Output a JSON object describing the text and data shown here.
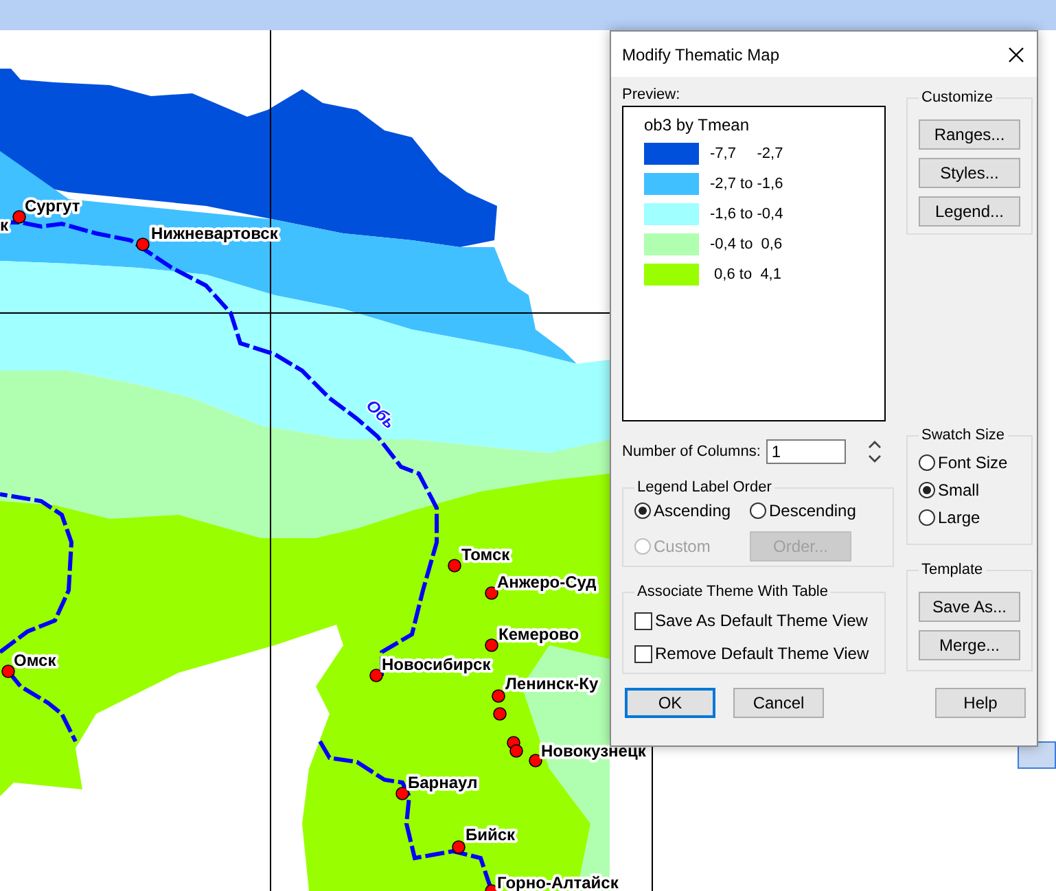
{
  "map": {
    "cities": [
      {
        "name": "к"
      },
      {
        "name": "Сургут"
      },
      {
        "name": "Нижневартовск"
      },
      {
        "name": "Омск"
      },
      {
        "name": "Томск"
      },
      {
        "name": "Анжеро-Суд"
      },
      {
        "name": "Кемерово"
      },
      {
        "name": "Новосибирск"
      },
      {
        "name": "Ленинск-Ку"
      },
      {
        "name": "Новокузнецк"
      },
      {
        "name": "Барнаул"
      },
      {
        "name": "Бийск"
      },
      {
        "name": "Горно-Алтайск"
      }
    ],
    "river_label": "Обь"
  },
  "dialog": {
    "title": "Modify Thematic Map",
    "preview_label": "Preview:",
    "legend": {
      "title": "ob3 by Tmean",
      "items": [
        {
          "color": "#0050dc",
          "label": "-7,7     -2,7"
        },
        {
          "color": "#40c0ff",
          "label": "-2,7 to -1,6"
        },
        {
          "color": "#a0ffff",
          "label": "-1,6 to -0,4"
        },
        {
          "color": "#b0ffb0",
          "label": "-0,4 to  0,6"
        },
        {
          "color": "#99ff00",
          "label": " 0,6 to  4,1"
        }
      ]
    },
    "customize": {
      "title": "Customize",
      "buttons": [
        "Ranges...",
        "Styles...",
        "Legend..."
      ]
    },
    "number_of_columns": {
      "label": "Number of Columns:",
      "value": "1"
    },
    "legend_label_order": {
      "title": "Legend Label Order",
      "options": [
        {
          "label": "Ascending",
          "selected": true,
          "disabled": false
        },
        {
          "label": "Descending",
          "selected": false,
          "disabled": false
        },
        {
          "label": "Custom",
          "selected": false,
          "disabled": true
        }
      ],
      "order_button": {
        "label": "Order...",
        "disabled": true
      }
    },
    "associate": {
      "title": "Associate Theme With Table",
      "checkboxes": [
        {
          "label": "Save As Default Theme View",
          "checked": false
        },
        {
          "label": "Remove Default Theme View",
          "checked": false
        }
      ]
    },
    "swatch_size": {
      "title": "Swatch Size",
      "options": [
        {
          "label": "Font Size",
          "selected": false
        },
        {
          "label": "Small",
          "selected": true
        },
        {
          "label": "Large",
          "selected": false
        }
      ]
    },
    "template": {
      "title": "Template",
      "buttons": [
        "Save As...",
        "Merge..."
      ]
    },
    "footer": [
      {
        "label": "OK",
        "focused": true
      },
      {
        "label": "Cancel",
        "focused": false
      },
      {
        "label": "Help",
        "focused": false
      }
    ]
  }
}
